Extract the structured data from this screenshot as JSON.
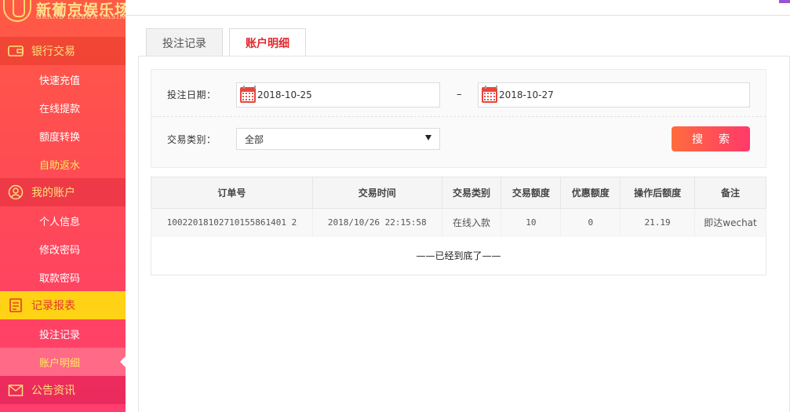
{
  "logo": {
    "name": "新葡京娱乐场",
    "sub": "GRAND LISBOA CASINO"
  },
  "sidebar": {
    "groups": [
      {
        "label": "银行交易",
        "icon": "wallet-icon",
        "items": [
          {
            "label": "快速充值"
          },
          {
            "label": "在线提款"
          },
          {
            "label": "额度转换"
          },
          {
            "label": "自助返水"
          }
        ]
      },
      {
        "label": "我的账户",
        "icon": "user-icon",
        "items": [
          {
            "label": "个人信息"
          },
          {
            "label": "修改密码"
          },
          {
            "label": "取款密码"
          }
        ]
      },
      {
        "label": "记录报表",
        "icon": "report-icon",
        "items": [
          {
            "label": "投注记录"
          },
          {
            "label": "账户明细"
          }
        ]
      },
      {
        "label": "公告资讯",
        "icon": "envelope-icon",
        "items": []
      }
    ],
    "active_item": "账户明细"
  },
  "tabs": [
    {
      "label": "投注记录"
    },
    {
      "label": "账户明细"
    }
  ],
  "filter": {
    "date_label": "投注日期：",
    "date_from": "2018-10-25",
    "separator": "–",
    "date_to": "2018-10-27",
    "type_label": "交易类别：",
    "type_value": "全部",
    "search_label": "搜索"
  },
  "table": {
    "headers": [
      "订单号",
      "交易时间",
      "交易类别",
      "交易额度",
      "优惠额度",
      "操作后额度",
      "备注"
    ],
    "rows": [
      [
        "10022018102710155861401 2",
        "2018/10/26 22:15:58",
        "在线入款",
        "10",
        "0",
        "21.19",
        "即达wechat"
      ]
    ],
    "end_note": "——已经到底了——"
  },
  "colors": {
    "accent": "#e0282d",
    "sidebar_top": "#ff5a45",
    "sidebar_bottom": "#ff3d6e",
    "highlight": "#ffd215"
  }
}
